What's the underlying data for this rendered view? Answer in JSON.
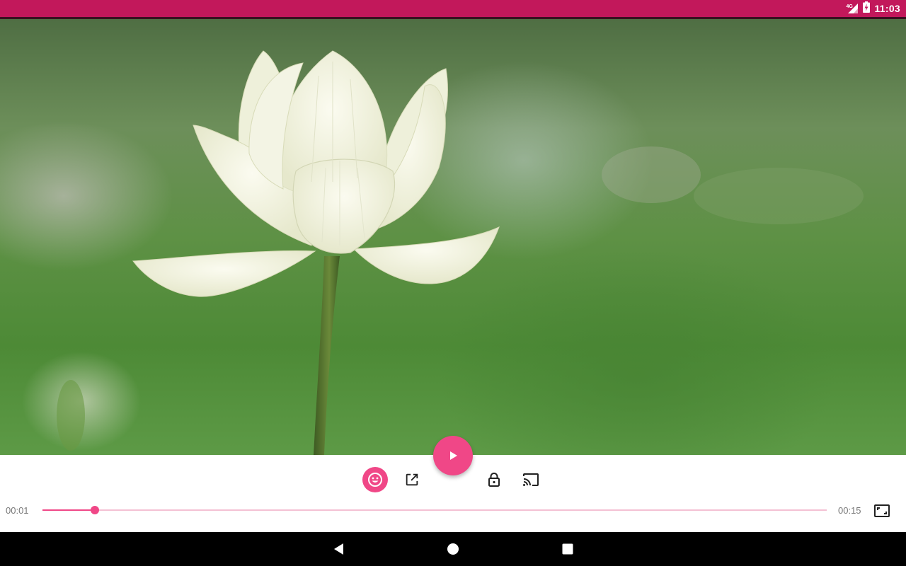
{
  "status_bar": {
    "network_type": "4G",
    "time": "11:03",
    "color": "#c2185b"
  },
  "video": {
    "subject": "white-lotus-flower"
  },
  "player": {
    "accent_color": "#f04787",
    "current_time": "00:01",
    "duration": "00:15",
    "progress_percent": 6.7,
    "buttons": {
      "play": "play-icon",
      "emoji": "emoji-icon",
      "share": "open-in-new-icon",
      "lock": "lock-icon",
      "cast": "cast-icon",
      "fullscreen": "fullscreen-icon"
    }
  },
  "nav_bar": {
    "back": "back-icon",
    "home": "home-icon",
    "recents": "recents-icon"
  }
}
